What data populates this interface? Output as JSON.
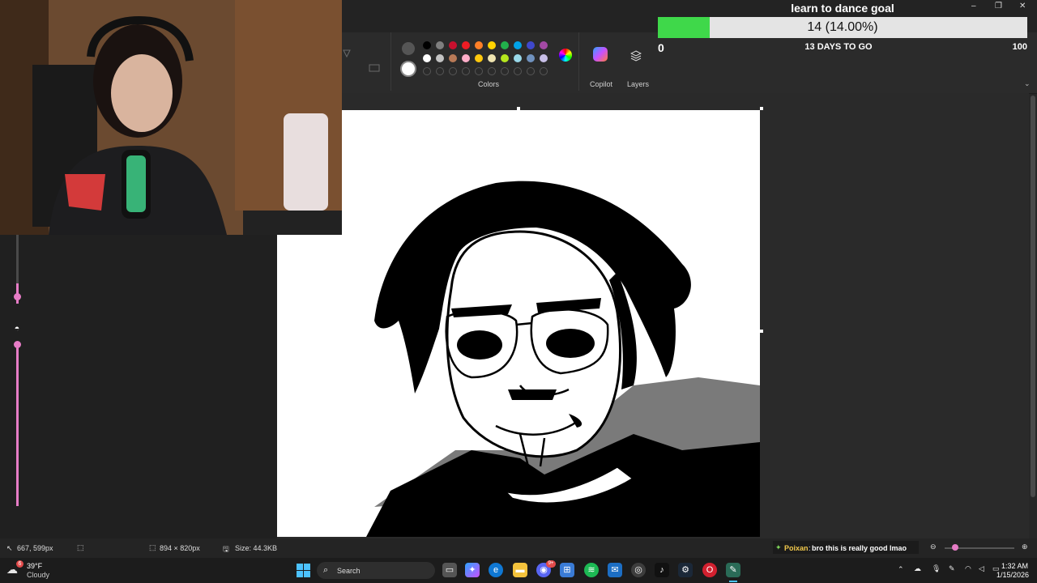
{
  "goal": {
    "title": "learn to dance goal",
    "progress_text": "14 (14.00%)",
    "progress_fraction": 0.14,
    "min_label": "0",
    "max_label": "100",
    "days_left": "13 DAYS TO GO",
    "bar_color": "#3fd84a"
  },
  "ribbon": {
    "colors_label": "Colors",
    "copilot_label": "Copilot",
    "layers_label": "Layers",
    "palette_row1": [
      "#000000",
      "#7f7f7f",
      "#c8102e",
      "#ee1c24",
      "#ff7f27",
      "#ffd200",
      "#22b14c",
      "#00a2e8",
      "#3f48cc",
      "#a349a4"
    ],
    "palette_row2": [
      "#ffffff",
      "#c3c3c3",
      "#b97a57",
      "#ffaec9",
      "#ffc90e",
      "#efe4b0",
      "#b5e61d",
      "#99d9ea",
      "#7092be",
      "#c8bfe7"
    ]
  },
  "status": {
    "cursor_pos": "667, 599px",
    "canvas_size": "894 × 820px",
    "file_size": "Size: 44.3KB"
  },
  "chat": {
    "user": "Poixan",
    "message": "bro this is really good lmao"
  },
  "taskbar": {
    "weather_temp": "39°F",
    "weather_desc": "Cloudy",
    "search_placeholder": "Search",
    "time": "1:32 AM",
    "date": "1/15/2026",
    "badge_discord": "9+",
    "badge_weather": "6"
  }
}
